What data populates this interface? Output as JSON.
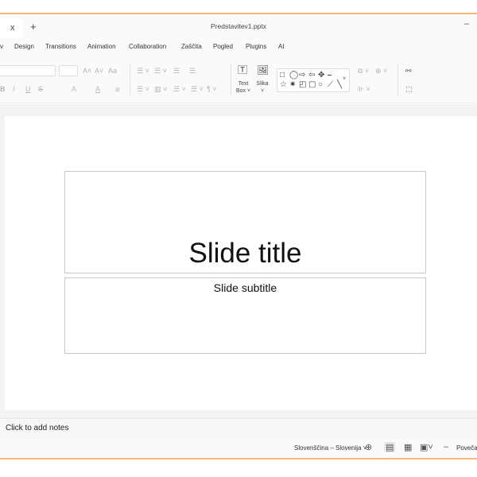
{
  "window": {
    "tab_close": "x",
    "new_tab": "+",
    "document_title": "Predstavitev1.pptx",
    "minimize": "–"
  },
  "menu": {
    "items": [
      "v",
      "Design",
      "Transitions",
      "Animation",
      "Collaboration",
      "Zaščita",
      "Pogled",
      "Plugins",
      "AI"
    ]
  },
  "ribbon": {
    "font_size_icons": [
      "A˄",
      "A˅",
      "Aa"
    ],
    "format_icons": [
      "B",
      "I",
      "U",
      "S",
      "A",
      "A"
    ],
    "text_box_label_1": "Text",
    "text_box_label_2": "Box ˅",
    "image_label_1": "Slika",
    "image_label_2": "˅"
  },
  "slide": {
    "title": "Slide title",
    "subtitle": "Slide subtitle"
  },
  "notes": {
    "placeholder": "Click to add notes"
  },
  "status": {
    "language": "Slovenščina – Slovenija ˅",
    "zoom_label": "Poveča"
  },
  "colors": {
    "frame_accent": "#f5b97a"
  },
  "icons": {
    "globe": "globe-icon",
    "normal_view": "normal-view-icon",
    "slide_sorter": "slide-sorter-icon",
    "reading_view": "reading-view-icon",
    "zoom_out": "zoom-out-icon"
  }
}
